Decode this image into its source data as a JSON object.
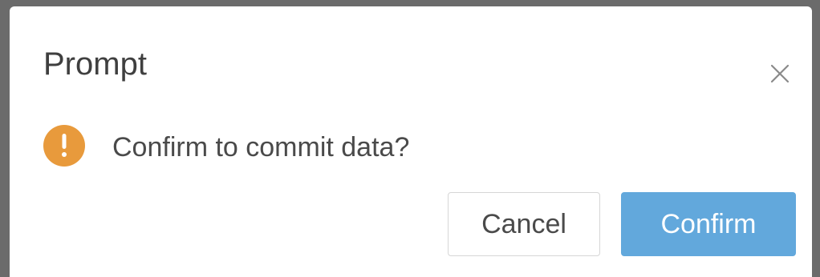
{
  "dialog": {
    "title": "Prompt",
    "message": "Confirm to commit data?",
    "close_icon": "close-icon",
    "message_icon": "warning-exclamation-icon",
    "cancel_label": "Cancel",
    "confirm_label": "Confirm"
  },
  "colors": {
    "backdrop": "#6b6b6b",
    "dialog_bg": "#ffffff",
    "warning": "#e89a3c",
    "primary": "#62a8dc",
    "text": "#4a4a4a"
  }
}
